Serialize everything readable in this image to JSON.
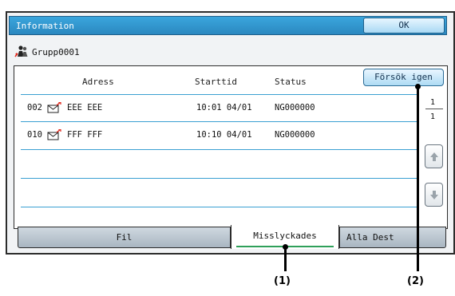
{
  "window": {
    "title": "Information",
    "ok_label": "OK"
  },
  "group": {
    "name": "Grupp0001",
    "icon": "group-people-icon"
  },
  "list": {
    "headers": {
      "address": "Adress",
      "start_time": "Starttid",
      "status": "Status"
    },
    "retry_label": "Försök igen",
    "rows": [
      {
        "index": "002",
        "icon": "mail-icon",
        "address": "EEE EEE",
        "start_time": "10:01 04/01",
        "status": "NG000000"
      },
      {
        "index": "010",
        "icon": "mail-icon",
        "address": "FFF FFF",
        "start_time": "10:10 04/01",
        "status": "NG000000"
      }
    ],
    "pager": {
      "current": "1",
      "total": "1"
    }
  },
  "tabs": [
    {
      "label": "Fil",
      "selected": false
    },
    {
      "label": "Misslyckades",
      "selected": true
    },
    {
      "label": "Alla Dest",
      "selected": false
    }
  ],
  "callouts": [
    "(1)",
    "(2)"
  ],
  "colors": {
    "title_bar": "#2b88c0",
    "button_face": "#aedbf4",
    "tab_underline": "#2fa05a",
    "row_rule": "#3aa0d2"
  }
}
